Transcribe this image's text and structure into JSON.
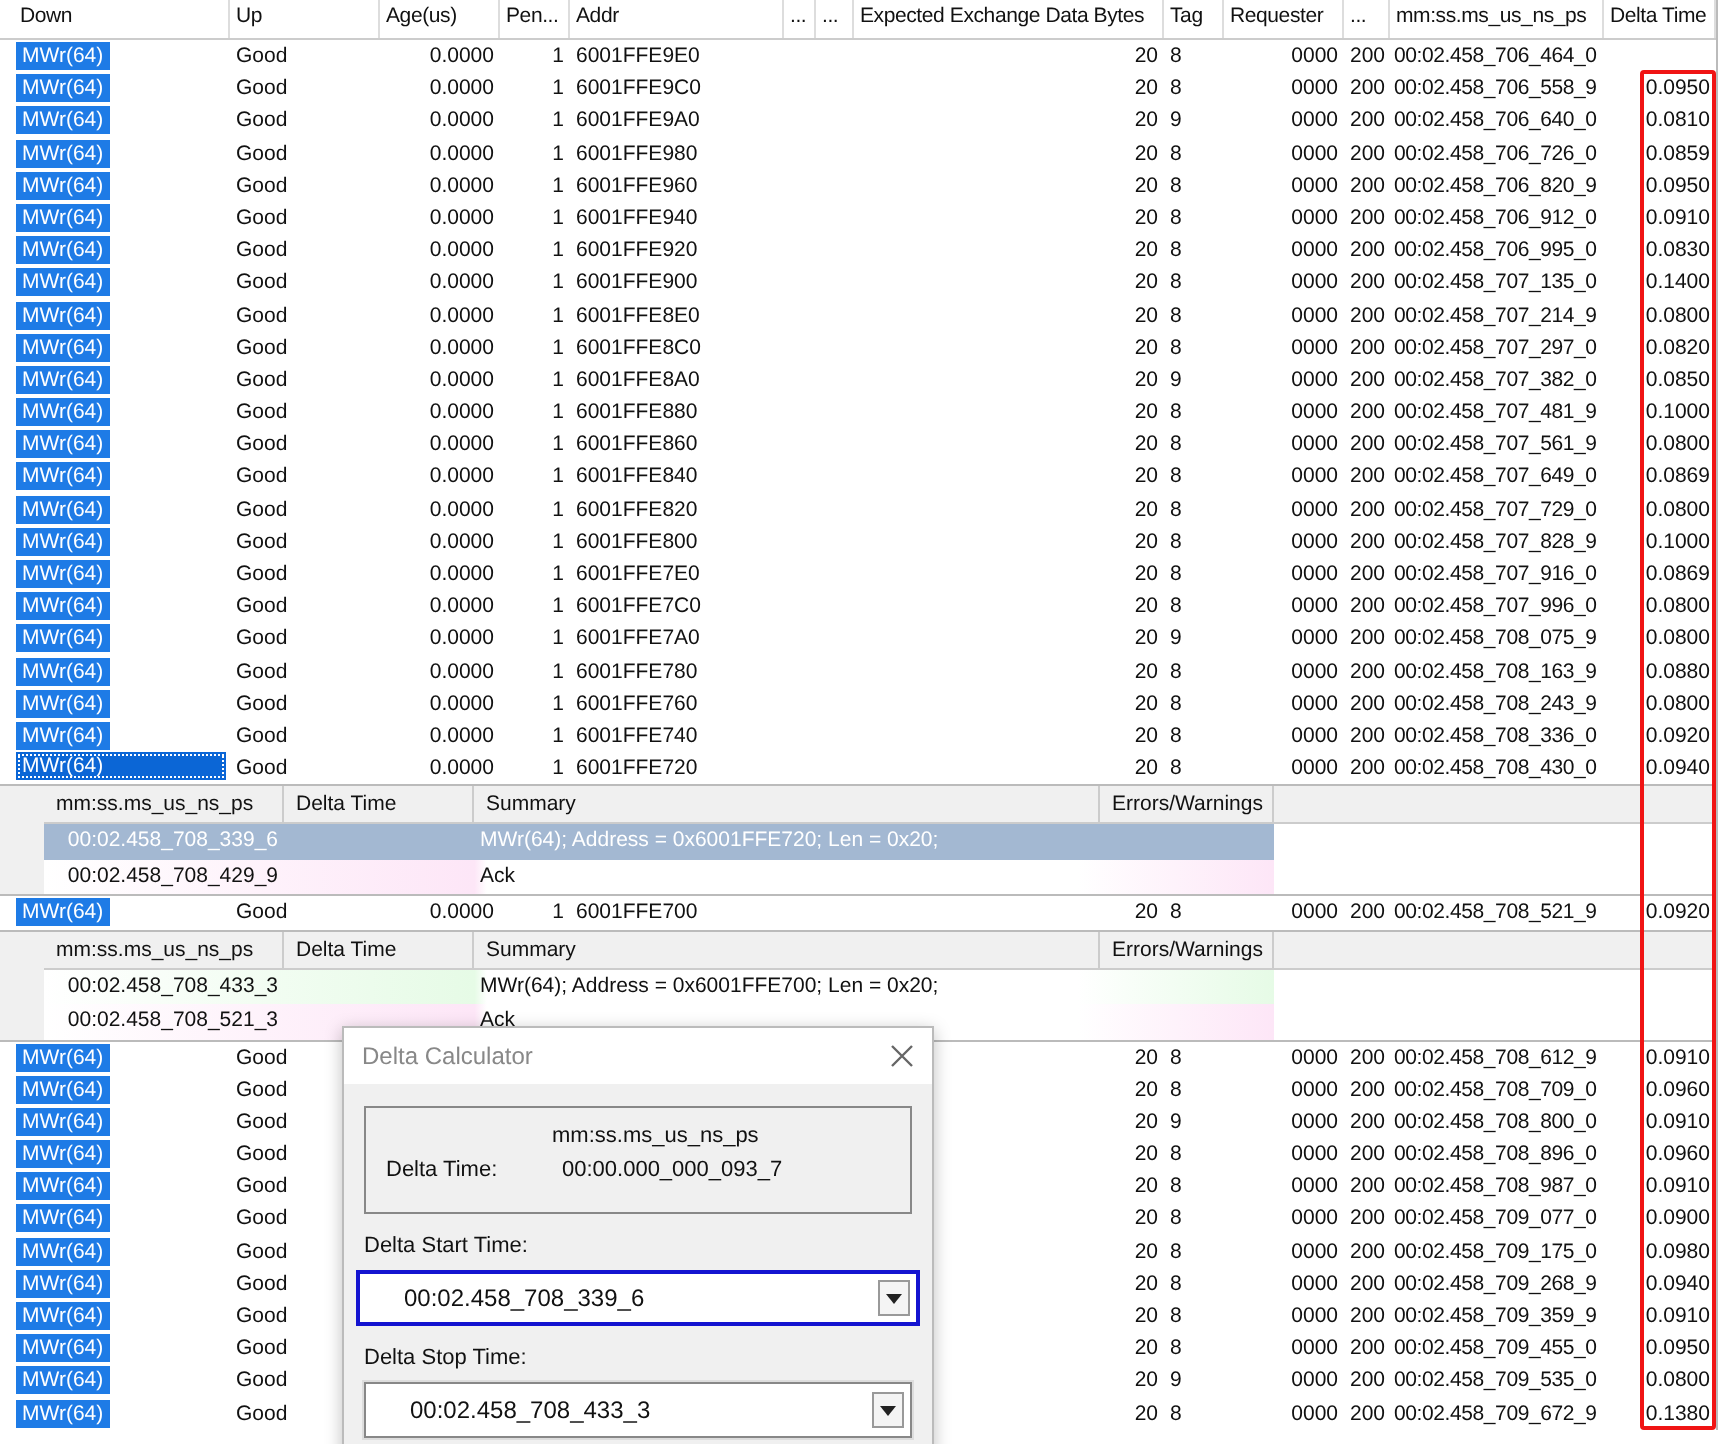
{
  "table": {
    "columns": [
      "Down",
      "Up",
      "Age(us)",
      "Pen...",
      "Addr",
      "...",
      "...",
      "Expected Exchange Data Bytes",
      "Tag",
      "Requester",
      "...",
      "mm:ss.ms_us_ns_ps",
      "Delta Time"
    ],
    "items": [
      {
        "kind": "row",
        "type": "MWr(64)",
        "status": "Good",
        "age": "0.0000",
        "pending": "1",
        "addr": "6001FFE9E0",
        "bytes": "20",
        "tag": "8",
        "requester": "0000",
        "column_11": "200",
        "time": "00:02.458_706_464_0",
        "selected": false
      },
      {
        "kind": "row",
        "type": "MWr(64)",
        "status": "Good",
        "age": "0.0000",
        "pending": "1",
        "addr": "6001FFE9C0",
        "bytes": "20",
        "tag": "8",
        "requester": "0000",
        "column_11": "200",
        "time": "00:02.458_706_558_9",
        "delta": "0.0950",
        "selected": false
      },
      {
        "kind": "row",
        "type": "MWr(64)",
        "status": "Good",
        "age": "0.0000",
        "pending": "1",
        "addr": "6001FFE9A0",
        "bytes": "20",
        "tag": "9",
        "requester": "0000",
        "column_11": "200",
        "time": "00:02.458_706_640_0",
        "delta": "0.0810",
        "selected": false
      },
      {
        "kind": "row",
        "type": "MWr(64)",
        "status": "Good",
        "age": "0.0000",
        "pending": "1",
        "addr": "6001FFE980",
        "bytes": "20",
        "tag": "8",
        "requester": "0000",
        "column_11": "200",
        "time": "00:02.458_706_726_0",
        "delta": "0.0859",
        "selected": false
      },
      {
        "kind": "row",
        "type": "MWr(64)",
        "status": "Good",
        "age": "0.0000",
        "pending": "1",
        "addr": "6001FFE960",
        "bytes": "20",
        "tag": "8",
        "requester": "0000",
        "column_11": "200",
        "time": "00:02.458_706_820_9",
        "delta": "0.0950",
        "selected": false
      },
      {
        "kind": "row",
        "type": "MWr(64)",
        "status": "Good",
        "age": "0.0000",
        "pending": "1",
        "addr": "6001FFE940",
        "bytes": "20",
        "tag": "8",
        "requester": "0000",
        "column_11": "200",
        "time": "00:02.458_706_912_0",
        "delta": "0.0910",
        "selected": false
      },
      {
        "kind": "row",
        "type": "MWr(64)",
        "status": "Good",
        "age": "0.0000",
        "pending": "1",
        "addr": "6001FFE920",
        "bytes": "20",
        "tag": "8",
        "requester": "0000",
        "column_11": "200",
        "time": "00:02.458_706_995_0",
        "delta": "0.0830",
        "selected": false
      },
      {
        "kind": "row",
        "type": "MWr(64)",
        "status": "Good",
        "age": "0.0000",
        "pending": "1",
        "addr": "6001FFE900",
        "bytes": "20",
        "tag": "8",
        "requester": "0000",
        "column_11": "200",
        "time": "00:02.458_707_135_0",
        "delta": "0.1400",
        "selected": false
      },
      {
        "kind": "row",
        "type": "MWr(64)",
        "status": "Good",
        "age": "0.0000",
        "pending": "1",
        "addr": "6001FFE8E0",
        "bytes": "20",
        "tag": "8",
        "requester": "0000",
        "column_11": "200",
        "time": "00:02.458_707_214_9",
        "delta": "0.0800",
        "selected": false
      },
      {
        "kind": "row",
        "type": "MWr(64)",
        "status": "Good",
        "age": "0.0000",
        "pending": "1",
        "addr": "6001FFE8C0",
        "bytes": "20",
        "tag": "8",
        "requester": "0000",
        "column_11": "200",
        "time": "00:02.458_707_297_0",
        "delta": "0.0820",
        "selected": false
      },
      {
        "kind": "row",
        "type": "MWr(64)",
        "status": "Good",
        "age": "0.0000",
        "pending": "1",
        "addr": "6001FFE8A0",
        "bytes": "20",
        "tag": "9",
        "requester": "0000",
        "column_11": "200",
        "time": "00:02.458_707_382_0",
        "delta": "0.0850",
        "selected": false
      },
      {
        "kind": "row",
        "type": "MWr(64)",
        "status": "Good",
        "age": "0.0000",
        "pending": "1",
        "addr": "6001FFE880",
        "bytes": "20",
        "tag": "8",
        "requester": "0000",
        "column_11": "200",
        "time": "00:02.458_707_481_9",
        "delta": "0.1000",
        "selected": false
      },
      {
        "kind": "row",
        "type": "MWr(64)",
        "status": "Good",
        "age": "0.0000",
        "pending": "1",
        "addr": "6001FFE860",
        "bytes": "20",
        "tag": "8",
        "requester": "0000",
        "column_11": "200",
        "time": "00:02.458_707_561_9",
        "delta": "0.0800",
        "selected": false
      },
      {
        "kind": "row",
        "type": "MWr(64)",
        "status": "Good",
        "age": "0.0000",
        "pending": "1",
        "addr": "6001FFE840",
        "bytes": "20",
        "tag": "8",
        "requester": "0000",
        "column_11": "200",
        "time": "00:02.458_707_649_0",
        "delta": "0.0869",
        "selected": false
      },
      {
        "kind": "row",
        "type": "MWr(64)",
        "status": "Good",
        "age": "0.0000",
        "pending": "1",
        "addr": "6001FFE820",
        "bytes": "20",
        "tag": "8",
        "requester": "0000",
        "column_11": "200",
        "time": "00:02.458_707_729_0",
        "delta": "0.0800",
        "selected": false
      },
      {
        "kind": "row",
        "type": "MWr(64)",
        "status": "Good",
        "age": "0.0000",
        "pending": "1",
        "addr": "6001FFE800",
        "bytes": "20",
        "tag": "8",
        "requester": "0000",
        "column_11": "200",
        "time": "00:02.458_707_828_9",
        "delta": "0.1000",
        "selected": false
      },
      {
        "kind": "row",
        "type": "MWr(64)",
        "status": "Good",
        "age": "0.0000",
        "pending": "1",
        "addr": "6001FFE7E0",
        "bytes": "20",
        "tag": "8",
        "requester": "0000",
        "column_11": "200",
        "time": "00:02.458_707_916_0",
        "delta": "0.0869",
        "selected": false
      },
      {
        "kind": "row",
        "type": "MWr(64)",
        "status": "Good",
        "age": "0.0000",
        "pending": "1",
        "addr": "6001FFE7C0",
        "bytes": "20",
        "tag": "8",
        "requester": "0000",
        "column_11": "200",
        "time": "00:02.458_707_996_0",
        "delta": "0.0800",
        "selected": false
      },
      {
        "kind": "row",
        "type": "MWr(64)",
        "status": "Good",
        "age": "0.0000",
        "pending": "1",
        "addr": "6001FFE7A0",
        "bytes": "20",
        "tag": "9",
        "requester": "0000",
        "column_11": "200",
        "time": "00:02.458_708_075_9",
        "delta": "0.0800",
        "selected": false
      },
      {
        "kind": "row",
        "type": "MWr(64)",
        "status": "Good",
        "age": "0.0000",
        "pending": "1",
        "addr": "6001FFE780",
        "bytes": "20",
        "tag": "8",
        "requester": "0000",
        "column_11": "200",
        "time": "00:02.458_708_163_9",
        "delta": "0.0880",
        "selected": false
      },
      {
        "kind": "row",
        "type": "MWr(64)",
        "status": "Good",
        "age": "0.0000",
        "pending": "1",
        "addr": "6001FFE760",
        "bytes": "20",
        "tag": "8",
        "requester": "0000",
        "column_11": "200",
        "time": "00:02.458_708_243_9",
        "delta": "0.0800",
        "selected": false
      },
      {
        "kind": "row",
        "type": "MWr(64)",
        "status": "Good",
        "age": "0.0000",
        "pending": "1",
        "addr": "6001FFE740",
        "bytes": "20",
        "tag": "8",
        "requester": "0000",
        "column_11": "200",
        "time": "00:02.458_708_336_0",
        "delta": "0.0920",
        "selected": false
      },
      {
        "kind": "row",
        "type": "MWr(64)",
        "status": "Good",
        "age": "0.0000",
        "pending": "1",
        "addr": "6001FFE720",
        "bytes": "20",
        "tag": "8",
        "requester": "0000",
        "column_11": "200",
        "time": "00:02.458_708_430_0",
        "delta": "0.0940",
        "selected": true
      },
      {
        "kind": "detail",
        "columns": [
          "mm:ss.ms_us_ns_ps",
          "Delta Time",
          "Summary",
          "Errors/Warnings"
        ],
        "lines": [
          {
            "kind": "request",
            "time": "00:02.458_708_339_6",
            "summary": "MWr(64); Address = 0x6001FFE720; Len = 0x20;",
            "selected": true
          },
          {
            "kind": "ack",
            "time": "00:02.458_708_429_9",
            "summary": "Ack",
            "selected": false
          }
        ]
      },
      {
        "kind": "row",
        "type": "MWr(64)",
        "status": "Good",
        "age": "0.0000",
        "pending": "1",
        "addr": "6001FFE700",
        "bytes": "20",
        "tag": "8",
        "requester": "0000",
        "column_11": "200",
        "time": "00:02.458_708_521_9",
        "delta": "0.0920",
        "selected": false
      },
      {
        "kind": "detail",
        "columns": [
          "mm:ss.ms_us_ns_ps",
          "Delta Time",
          "Summary",
          "Errors/Warnings"
        ],
        "lines": [
          {
            "kind": "request",
            "time": "00:02.458_708_433_3",
            "summary": "MWr(64); Address = 0x6001FFE700; Len = 0x20;",
            "selected": false
          },
          {
            "kind": "ack",
            "time": "00:02.458_708_521_3",
            "summary": "Ack",
            "selected": false
          }
        ]
      },
      {
        "kind": "row",
        "type": "MWr(64)",
        "status": "Good",
        "bytes": "20",
        "tag": "8",
        "requester": "0000",
        "column_11": "200",
        "time": "00:02.458_708_612_9",
        "delta": "0.0910",
        "selected": false
      },
      {
        "kind": "row",
        "type": "MWr(64)",
        "status": "Good",
        "bytes": "20",
        "tag": "8",
        "requester": "0000",
        "column_11": "200",
        "time": "00:02.458_708_709_0",
        "delta": "0.0960",
        "selected": false
      },
      {
        "kind": "row",
        "type": "MWr(64)",
        "status": "Good",
        "bytes": "20",
        "tag": "9",
        "requester": "0000",
        "column_11": "200",
        "time": "00:02.458_708_800_0",
        "delta": "0.0910",
        "selected": false
      },
      {
        "kind": "row",
        "type": "MWr(64)",
        "status": "Good",
        "bytes": "20",
        "tag": "8",
        "requester": "0000",
        "column_11": "200",
        "time": "00:02.458_708_896_0",
        "delta": "0.0960",
        "selected": false
      },
      {
        "kind": "row",
        "type": "MWr(64)",
        "status": "Good",
        "bytes": "20",
        "tag": "8",
        "requester": "0000",
        "column_11": "200",
        "time": "00:02.458_708_987_0",
        "delta": "0.0910",
        "selected": false
      },
      {
        "kind": "row",
        "type": "MWr(64)",
        "status": "Good",
        "bytes": "20",
        "tag": "8",
        "requester": "0000",
        "column_11": "200",
        "time": "00:02.458_709_077_0",
        "delta": "0.0900",
        "selected": false
      },
      {
        "kind": "row",
        "type": "MWr(64)",
        "status": "Good",
        "bytes": "20",
        "tag": "8",
        "requester": "0000",
        "column_11": "200",
        "time": "00:02.458_709_175_0",
        "delta": "0.0980",
        "selected": false
      },
      {
        "kind": "row",
        "type": "MWr(64)",
        "status": "Good",
        "bytes": "20",
        "tag": "8",
        "requester": "0000",
        "column_11": "200",
        "time": "00:02.458_709_268_9",
        "delta": "0.0940",
        "selected": false
      },
      {
        "kind": "row",
        "type": "MWr(64)",
        "status": "Good",
        "bytes": "20",
        "tag": "8",
        "requester": "0000",
        "column_11": "200",
        "time": "00:02.458_709_359_9",
        "delta": "0.0910",
        "selected": false
      },
      {
        "kind": "row",
        "type": "MWr(64)",
        "status": "Good",
        "bytes": "20",
        "tag": "8",
        "requester": "0000",
        "column_11": "200",
        "time": "00:02.458_709_455_0",
        "delta": "0.0950",
        "selected": false
      },
      {
        "kind": "row",
        "type": "MWr(64)",
        "status": "Good",
        "bytes": "20",
        "tag": "9",
        "requester": "0000",
        "column_11": "200",
        "time": "00:02.458_709_535_0",
        "delta": "0.0800",
        "selected": false
      },
      {
        "kind": "row",
        "type": "MWr(64)",
        "status": "Good",
        "bytes": "20",
        "tag": "8",
        "requester": "0000",
        "column_11": "200",
        "time": "00:02.458_709_672_9",
        "delta": "0.1380",
        "selected": false
      }
    ]
  },
  "dialog": {
    "title": "Delta Calculator",
    "unit_label": "mm:ss.ms_us_ns_ps",
    "delta_label": "Delta Time:",
    "delta_value": "00:00.000_000_093_7",
    "fields": [
      {
        "label": "Delta Start Time:",
        "value": "00:02.458_708_339_6",
        "focused": true
      },
      {
        "label": "Delta Stop Time:",
        "value": "00:02.458_708_433_3",
        "focused": false
      }
    ]
  }
}
